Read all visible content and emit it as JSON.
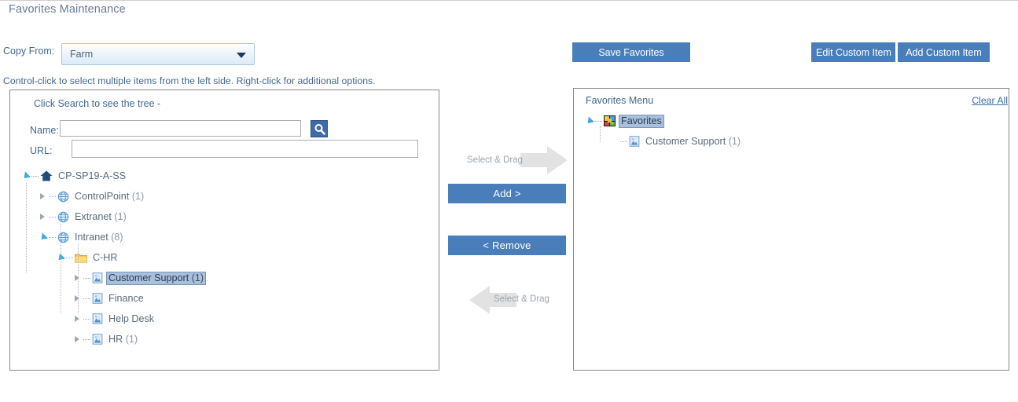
{
  "page": {
    "title": "Favorites Maintenance",
    "hint": "Control-click to select multiple items from the left side. Right-click for additional options."
  },
  "copy_from": {
    "label": "Copy From:",
    "selected": "Farm",
    "caret_icon": "chevron-down-icon"
  },
  "toolbar": {
    "save_favorites": "Save Favorites",
    "edit_custom_item": "Edit Custom Item",
    "add_custom_item": "Add Custom Item"
  },
  "left_panel": {
    "caption": "Click Search to see the tree -",
    "name_label": "Name:",
    "name_value": "",
    "name_placeholder": "",
    "url_label": "URL:",
    "url_value": "",
    "url_placeholder": "",
    "search_icon": "search-icon",
    "tree": [
      {
        "label": "CP-SP19-A-SS",
        "count": "",
        "icon": "home-icon",
        "depth": 0,
        "state": "expanded",
        "selected": false
      },
      {
        "label": "ControlPoint",
        "count": "(1)",
        "icon": "globe-icon",
        "depth": 1,
        "state": "collapsed",
        "selected": false
      },
      {
        "label": "Extranet",
        "count": "(1)",
        "icon": "globe-icon",
        "depth": 1,
        "state": "collapsed",
        "selected": false
      },
      {
        "label": "Intranet",
        "count": "(8)",
        "icon": "globe-icon",
        "depth": 1,
        "state": "expanded",
        "selected": false
      },
      {
        "label": "C-HR",
        "count": "",
        "icon": "folder-icon",
        "depth": 2,
        "state": "expanded",
        "selected": false
      },
      {
        "label": "Customer Support",
        "count": "(1)",
        "icon": "site-icon",
        "depth": 3,
        "state": "collapsed",
        "selected": true
      },
      {
        "label": "Finance",
        "count": "",
        "icon": "site-icon",
        "depth": 3,
        "state": "collapsed",
        "selected": false
      },
      {
        "label": "Help Desk",
        "count": "",
        "icon": "site-icon",
        "depth": 3,
        "state": "collapsed",
        "selected": false
      },
      {
        "label": "HR",
        "count": "(1)",
        "icon": "site-icon",
        "depth": 3,
        "state": "collapsed",
        "selected": false
      }
    ]
  },
  "middle": {
    "drag_hint_right": "Select & Drag",
    "drag_hint_left": "Select & Drag",
    "add_label": "Add >",
    "remove_label": "< Remove"
  },
  "right_panel": {
    "caption": "Favorites Menu",
    "clear_all": "Clear All",
    "tree": [
      {
        "label": "Favorites",
        "count": "",
        "icon": "favorites-icon",
        "depth": 0,
        "state": "expanded",
        "selected": true
      },
      {
        "label": "Customer Support",
        "count": "(1)",
        "icon": "site-icon",
        "depth": 1,
        "state": "leaf",
        "selected": false
      }
    ]
  },
  "colors": {
    "accent_blue": "#4a7ebb",
    "label_blue": "#44688f",
    "title_gray": "#6b7a99",
    "tree_text": "#5a6b7d",
    "selection": "#a8c0dd",
    "panel_border": "#8a8a8a",
    "link": "#3b6ea5"
  }
}
